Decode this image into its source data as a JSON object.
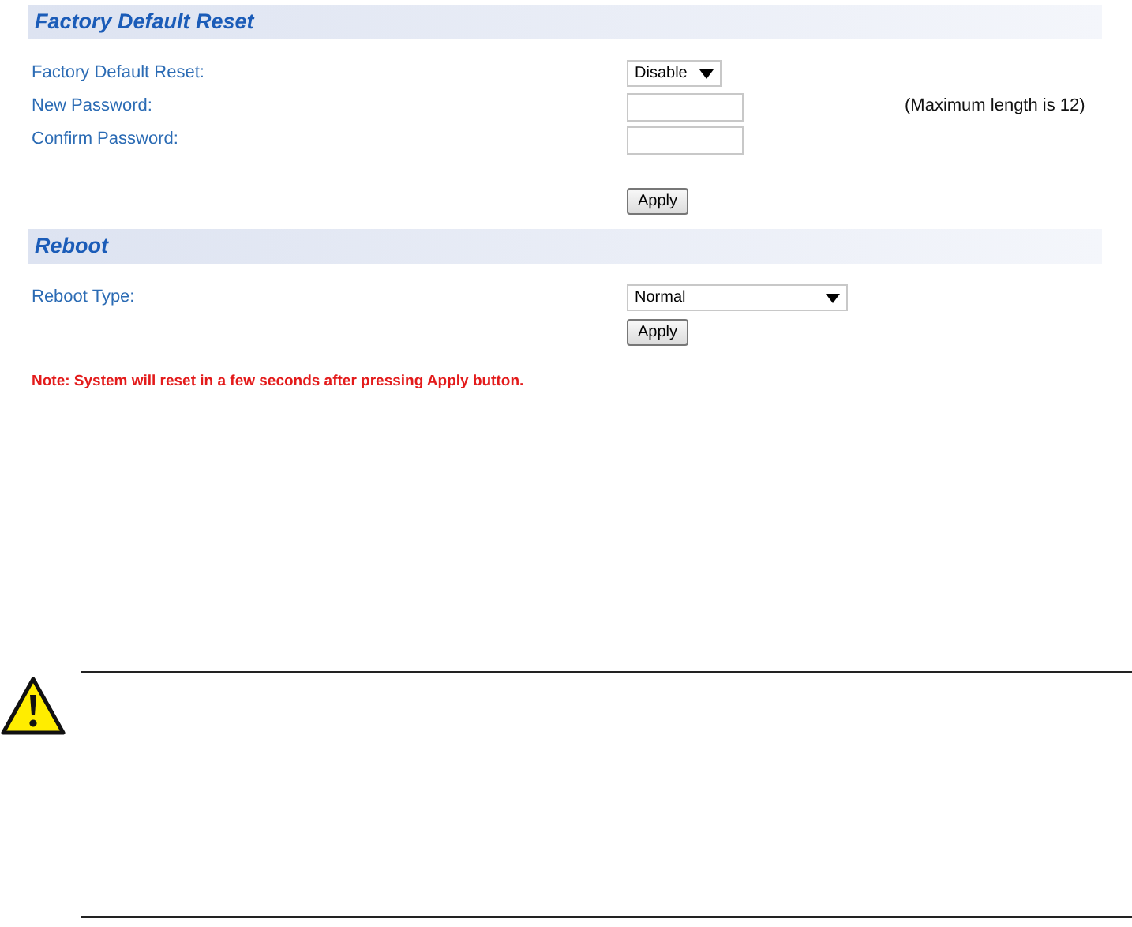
{
  "sections": [
    {
      "title": "Factory Default Reset",
      "fields": [
        {
          "kind": "select",
          "label": "Factory Default Reset:",
          "value": "Disable"
        },
        {
          "kind": "password",
          "label": "New Password:",
          "hint": "(Maximum length is 12)"
        },
        {
          "kind": "password",
          "label": "Confirm Password:"
        }
      ],
      "button": "Apply"
    },
    {
      "title": "Reboot",
      "fields": [
        {
          "kind": "select",
          "label": "Reboot Type:",
          "value": "Normal"
        }
      ],
      "button": "Apply"
    }
  ],
  "note": "Note: System will reset in a few seconds after pressing Apply button."
}
